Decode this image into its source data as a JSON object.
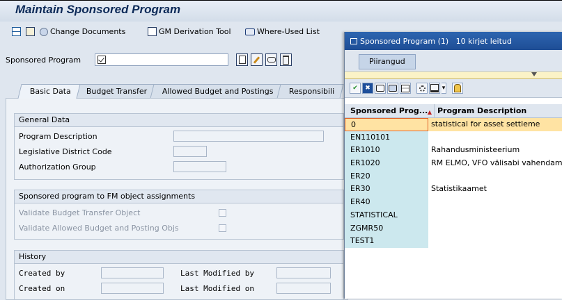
{
  "window": {
    "title": "Maintain Sponsored Program"
  },
  "toolbar": {
    "change_documents": "Change Documents",
    "gm_derivation": "GM Derivation Tool",
    "where_used": "Where-Used List"
  },
  "header_field": {
    "label": "Sponsored Program"
  },
  "tabs": [
    "Basic Data",
    "Budget Transfer",
    "Allowed Budget and Postings",
    "Responsibili"
  ],
  "general": {
    "title": "General Data",
    "program_description": "Program Description",
    "legislative_district": "Legislative District Code",
    "authorization_group": "Authorization Group"
  },
  "assignments": {
    "title": "Sponsored program to FM object assignments",
    "validate_budget": "Validate Budget Transfer Object",
    "validate_postings": "Validate Allowed Budget and Posting Objs"
  },
  "history": {
    "title": "History",
    "created_by": "Created by",
    "last_modified_by": "Last Modified by",
    "created_on": "Created on",
    "last_modified_on": "Last Modified on"
  },
  "popup": {
    "title": "Sponsored Program (1)   10 kirjet leitud",
    "restrictions_tab": "Piirangud",
    "columns": [
      "Sponsored Prog...",
      "Program Description"
    ],
    "rows": [
      {
        "code": "0",
        "desc": "statistical for asset settleme"
      },
      {
        "code": "EN110101",
        "desc": ""
      },
      {
        "code": "ER1010",
        "desc": "Rahandusministeerium"
      },
      {
        "code": "ER1020",
        "desc": "RM ELMO, VFO välisabi vahendam"
      },
      {
        "code": "ER20",
        "desc": ""
      },
      {
        "code": "ER30",
        "desc": "Statistikaamet"
      },
      {
        "code": "ER40",
        "desc": ""
      },
      {
        "code": "STATISTICAL",
        "desc": ""
      },
      {
        "code": "ZGMR50",
        "desc": ""
      },
      {
        "code": "TEST1",
        "desc": ""
      }
    ]
  },
  "colors": {
    "title_bar": "#1e4d95",
    "accent_row": "#ffe3a3",
    "key_column": "#cce8ee"
  }
}
